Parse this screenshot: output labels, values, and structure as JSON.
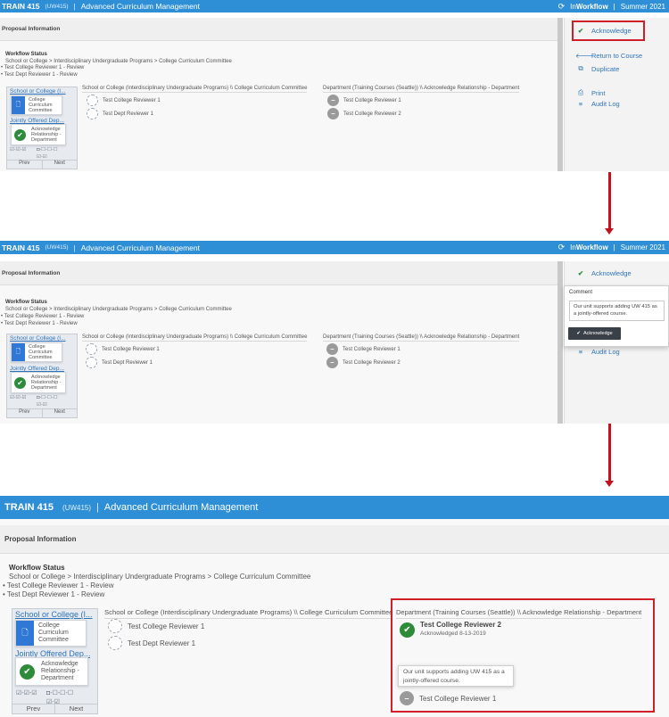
{
  "app": {
    "code": "TRAIN 415",
    "sub": "(UW415)",
    "sep": "|",
    "title": "Advanced Curriculum Management",
    "brand_prefix": "In",
    "brand_bold": "Workflow",
    "brand_sep": "|",
    "term": "Summer 2021"
  },
  "section": {
    "title": "Proposal Information"
  },
  "workflow": {
    "title": "Workflow Status",
    "path": "School or College > Interdisciplinary Undergraduate Programs > College Curriculum Committee",
    "bullets": [
      "Test College Reviewer 1 - Review",
      "Test Dept Reviewer 1 - Review"
    ]
  },
  "thumbnail": {
    "title1": "School or College (I...",
    "node1": "College Curriculum Committee",
    "title2": "Jointly Offered Dep...",
    "node2": "Acknowledge Relationship - Department",
    "mini_a": "☑-☑-☑",
    "mini_b": "◘-☐-☐-☐",
    "mini_c": "☑-☑",
    "prev": "Prev",
    "next": "Next"
  },
  "columns": {
    "school": "School or College (Interdisciplinary Undergraduate Programs) \\\\ College Curriculum Committee",
    "dept": "Department (Training Courses (Seattle)) \\\\ Acknowledge Relationship - Department",
    "school_reviewers": [
      "Test College Reviewer 1",
      "Test Dept Reviewer 1"
    ],
    "dept_reviewers": [
      "Test College Reviewer 1",
      "Test College Reviewer 2"
    ]
  },
  "sidebar": {
    "acknowledge": "Acknowledge",
    "return_to_course": "Return to Course",
    "duplicate": "Duplicate",
    "print": "Print",
    "audit_log": "Audit Log"
  },
  "comment_popup": {
    "label": "Comment",
    "text": "Our unit supports adding UW 415 as a jointly-offered course.",
    "button": "Acknowledge"
  },
  "result": {
    "reviewer_done": "Test College Reviewer 2",
    "acknowledged": "Acknowledged 8-13-2019",
    "comment": "Our unit supports adding UW 415 as a jointly-offered course.",
    "reviewer_pending": "Test College Reviewer 1"
  },
  "icons": {
    "check": "check-icon",
    "arrow_left": "arrow-left-icon",
    "duplicate": "duplicate-icon",
    "print": "print-icon",
    "list": "list-icon",
    "refresh": "refresh-icon",
    "document": "document-icon",
    "minus": "minus-icon"
  },
  "colors": {
    "topbar": "#2e8fd6",
    "link": "#2f73b8",
    "success": "#2e8b3a",
    "highlight": "#d11f2a",
    "button_dark": "#3a4048"
  }
}
